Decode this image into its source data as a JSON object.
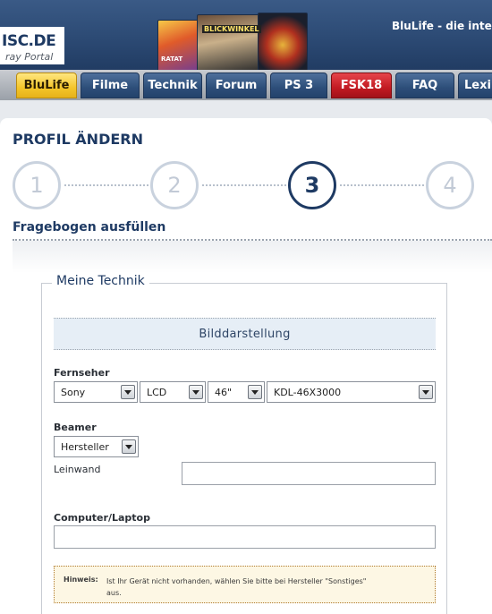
{
  "header": {
    "logo_text": "ISC.DE",
    "logo_sub": "ray Portal",
    "tagline": "BluLife - die inte",
    "cover_tag": "BLICKWINKEL",
    "cover_tag2": "RATAT"
  },
  "nav": {
    "items": [
      {
        "label": "BluLife",
        "state": "active"
      },
      {
        "label": "Filme"
      },
      {
        "label": "Technik"
      },
      {
        "label": "Forum"
      },
      {
        "label": "PS 3"
      },
      {
        "label": "FSK18",
        "color": "#c21a22"
      },
      {
        "label": "FAQ"
      },
      {
        "label": "Lexik"
      }
    ]
  },
  "page": {
    "title": "PROFIL ÄNDERN",
    "steps": [
      "1",
      "2",
      "3",
      "4"
    ],
    "current_step": "3",
    "subheading": "Fragebogen ausfüllen"
  },
  "form": {
    "legend": "Meine Technik",
    "section_title": "Bilddarstellung",
    "tv": {
      "label": "Fernseher",
      "brand": "Sony",
      "type": "LCD",
      "size": "46\"",
      "model": "KDL-46X3000"
    },
    "beamer": {
      "label": "Beamer",
      "manufacturer": "Hersteller",
      "screen_label": "Leinwand",
      "screen_value": ""
    },
    "computer": {
      "label": "Computer/Laptop",
      "value": ""
    },
    "hint": {
      "label": "Hinweis:",
      "text": "Ist Ihr Gerät nicht vorhanden, wählen Sie bitte bei Hersteller \"Sonstiges\" aus."
    }
  },
  "colors": {
    "primary": "#1e3a63",
    "nav_active": "#f4c52a",
    "nav_red": "#c21a22"
  }
}
